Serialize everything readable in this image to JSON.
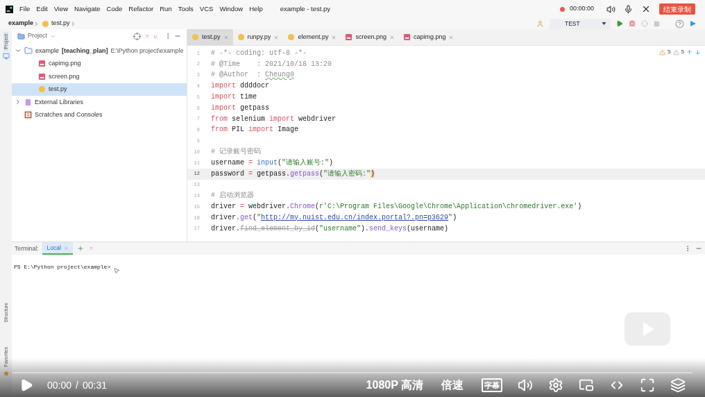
{
  "menu": [
    "File",
    "Edit",
    "View",
    "Navigate",
    "Code",
    "Refactor",
    "Run",
    "Tools",
    "VCS",
    "Window",
    "Help"
  ],
  "window": {
    "title": "example - test.py"
  },
  "recorder": {
    "time": "00:00:00",
    "stop_button": "结束录制"
  },
  "breadcrumb": [
    "example",
    "test.py"
  ],
  "run_config": "TEST",
  "side_tabs": [
    {
      "label": "Project",
      "selected": true
    },
    {
      "label": "Structure",
      "selected": false
    },
    {
      "label": "Favorites",
      "selected": false
    }
  ],
  "project": {
    "title": "Project",
    "tree": [
      {
        "kind": "folder",
        "name": "example",
        "module": "[teaching_plan]",
        "path": "E:\\Python project\\example",
        "expanded": true,
        "selected": false,
        "children": [
          {
            "kind": "image",
            "name": "capimg.png",
            "selected": false
          },
          {
            "kind": "image",
            "name": "screen.png",
            "selected": false
          },
          {
            "kind": "python",
            "name": "test.py",
            "selected": true
          }
        ]
      },
      {
        "kind": "library",
        "name": "External Libraries",
        "expanded": false,
        "selected": false
      },
      {
        "kind": "scratch",
        "name": "Scratches and Consoles",
        "selected": false
      }
    ]
  },
  "editor_tabs": [
    {
      "label": "test.py",
      "kind": "python",
      "selected": true
    },
    {
      "label": "runpy.py",
      "kind": "python",
      "selected": false
    },
    {
      "label": "element.py",
      "kind": "python",
      "selected": false
    },
    {
      "label": "screen.png",
      "kind": "image",
      "selected": false
    },
    {
      "label": "capimg.png",
      "kind": "image",
      "selected": false
    }
  ],
  "inspections": {
    "warnings": "5",
    "weak_warnings": "5"
  },
  "code": [
    {
      "number": "1",
      "current": false,
      "tokens": [
        {
          "text": "# -*- coding: utf-8 -*-",
          "kind": "comment"
        }
      ]
    },
    {
      "number": "2",
      "current": false,
      "tokens": [
        {
          "text": "# @Time    : 2021/10/18 13:20",
          "kind": "comment"
        }
      ]
    },
    {
      "number": "3",
      "current": false,
      "tokens": [
        {
          "text": "# @Author  : ",
          "kind": "comment"
        },
        {
          "text": "Cheung0",
          "kind": "typo"
        }
      ]
    },
    {
      "number": "4",
      "current": false,
      "tokens": [
        {
          "text": "import",
          "kind": "keyword"
        },
        {
          "text": " ddddocr",
          "kind": "plain"
        }
      ]
    },
    {
      "number": "5",
      "current": false,
      "tokens": [
        {
          "text": "import",
          "kind": "keyword"
        },
        {
          "text": " time",
          "kind": "plain"
        }
      ]
    },
    {
      "number": "6",
      "current": false,
      "tokens": [
        {
          "text": "import",
          "kind": "keyword"
        },
        {
          "text": " getpass",
          "kind": "plain"
        }
      ]
    },
    {
      "number": "7",
      "current": false,
      "tokens": [
        {
          "text": "from",
          "kind": "keyword"
        },
        {
          "text": " selenium ",
          "kind": "plain"
        },
        {
          "text": "import",
          "kind": "keyword"
        },
        {
          "text": " webdriver",
          "kind": "plain"
        }
      ]
    },
    {
      "number": "8",
      "current": false,
      "tokens": [
        {
          "text": "from",
          "kind": "keyword"
        },
        {
          "text": " PIL ",
          "kind": "plain"
        },
        {
          "text": "import",
          "kind": "keyword"
        },
        {
          "text": " Image",
          "kind": "plain"
        }
      ]
    },
    {
      "number": "9",
      "current": false
    },
    {
      "number": "10",
      "current": false,
      "tokens": [
        {
          "text": "# 记录账号密码",
          "kind": "comment"
        }
      ]
    },
    {
      "number": "11",
      "current": false,
      "tokens": [
        {
          "text": "username ",
          "kind": "plain"
        },
        {
          "text": "= ",
          "kind": "operator"
        },
        {
          "text": "input",
          "kind": "builtin"
        },
        {
          "text": "(",
          "kind": "plain"
        },
        {
          "text": "\"请输入账号:\"",
          "kind": "string"
        },
        {
          "text": ")",
          "kind": "plain"
        }
      ]
    },
    {
      "number": "12",
      "current": true,
      "tokens": [
        {
          "text": "password ",
          "kind": "plain"
        },
        {
          "text": "= ",
          "kind": "operator"
        },
        {
          "text": "getpass.",
          "kind": "plain"
        },
        {
          "text": "getpass",
          "kind": "method"
        },
        {
          "text": "(",
          "kind": "plain"
        },
        {
          "text": "\"请输入密码:\"",
          "kind": "string"
        },
        {
          "text": ")",
          "kind": "bracket"
        }
      ]
    },
    {
      "number": "13",
      "current": false
    },
    {
      "number": "14",
      "current": false,
      "tokens": [
        {
          "text": "# 启动浏览器",
          "kind": "comment"
        }
      ]
    },
    {
      "number": "15",
      "current": false,
      "tokens": [
        {
          "text": "driver ",
          "kind": "plain"
        },
        {
          "text": "= ",
          "kind": "operator"
        },
        {
          "text": "webdriver.",
          "kind": "plain"
        },
        {
          "text": "Chrome",
          "kind": "method"
        },
        {
          "text": "(",
          "kind": "plain"
        },
        {
          "text": "r'C:\\Program Files\\Google\\Chrome\\Application\\chromedriver.exe'",
          "kind": "string"
        },
        {
          "text": ")",
          "kind": "plain"
        }
      ]
    },
    {
      "number": "16",
      "current": false,
      "tokens": [
        {
          "text": "driver.",
          "kind": "plain"
        },
        {
          "text": "get",
          "kind": "method"
        },
        {
          "text": "(",
          "kind": "plain"
        },
        {
          "text": "\"",
          "kind": "string"
        },
        {
          "text": "http://my.nuist.edu.cn/index.portal?.pn=p3629",
          "kind": "link"
        },
        {
          "text": "\"",
          "kind": "string"
        },
        {
          "text": ")",
          "kind": "plain"
        }
      ]
    },
    {
      "number": "17",
      "current": false,
      "tokens": [
        {
          "text": "driver.",
          "kind": "plain"
        },
        {
          "text": "find_element_by_id",
          "kind": "deprecated"
        },
        {
          "text": "(",
          "kind": "plain"
        },
        {
          "text": "\"username\"",
          "kind": "string"
        },
        {
          "text": ").",
          "kind": "plain"
        },
        {
          "text": "send_keys",
          "kind": "method"
        },
        {
          "text": "(username)",
          "kind": "plain"
        }
      ]
    }
  ],
  "terminal": {
    "label": "Terminal:",
    "tabs": [
      {
        "label": "Local",
        "selected": true
      }
    ],
    "prompt": "PS E:\\Python project\\example>"
  },
  "player": {
    "time": "00:00",
    "separator": "/",
    "duration": "00:31",
    "quality": "1080P 高清",
    "speed": "倍速",
    "subtitle": "字幕",
    "subtitles_on": false
  }
}
